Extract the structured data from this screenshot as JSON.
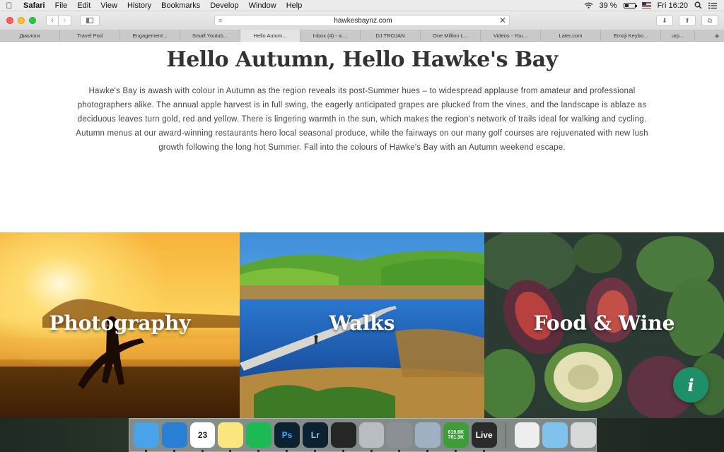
{
  "menubar": {
    "app_name": "Safari",
    "menus": [
      "File",
      "Edit",
      "View",
      "History",
      "Bookmarks",
      "Develop",
      "Window",
      "Help"
    ],
    "battery_percent": "39 %",
    "battery_level": 0.39,
    "clock": "Fri 16:20"
  },
  "browser": {
    "url": "hawkesbaynz.com",
    "tabs": [
      {
        "label": "Диалоги",
        "active": false
      },
      {
        "label": "Travel Pod",
        "active": false
      },
      {
        "label": "Engagement...",
        "active": false
      },
      {
        "label": "Small Youtub...",
        "active": false
      },
      {
        "label": "Hello Autum...",
        "active": true
      },
      {
        "label": "Inbox (4) - a....",
        "active": false
      },
      {
        "label": "DJ TROJAN",
        "active": false
      },
      {
        "label": "One Million L...",
        "active": false
      },
      {
        "label": "Videos - You...",
        "active": false
      },
      {
        "label": "Later.com",
        "active": false
      },
      {
        "label": "Emoji Keybo...",
        "active": false
      },
      {
        "label": "urp...",
        "active": false
      }
    ],
    "new_tab_label": "+"
  },
  "page": {
    "headline": "Hello Autumn, Hello Hawke's Bay",
    "intro": "Hawke's Bay is awash with colour in Autumn as the region reveals its post-Summer hues – to widespread applause from amateur and professional photographers alike. The annual apple harvest is in full swing, the eagerly anticipated grapes are plucked from the vines, and the landscape is ablaze as deciduous leaves turn gold, red and yellow. There is lingering warmth in the sun, which makes the region's network of trails ideal for walking and cycling. Autumn menus at our award-winning restaurants hero local seasonal produce, while the fairways on our many golf courses are rejuvenated with new lush growth following the long hot Summer. Fall into the colours of Hawke's Bay with an Autumn weekend escape.",
    "tiles": [
      {
        "label": "Photography",
        "image": "surfer-sunset-photo"
      },
      {
        "label": "Walks",
        "image": "wetland-boardwalk-photo"
      },
      {
        "label": "Food & Wine",
        "image": "feijoa-figs-photo"
      }
    ],
    "info_button_label": "i"
  },
  "dock": {
    "apps": [
      {
        "name": "finder-icon",
        "label": "",
        "bg": "#4aa3e8",
        "fg": "#fff"
      },
      {
        "name": "safari-icon",
        "label": "",
        "bg": "#2a7fd4",
        "fg": "#fff"
      },
      {
        "name": "calendar-icon",
        "label": "23",
        "bg": "#ffffff",
        "fg": "#222"
      },
      {
        "name": "notes-icon",
        "label": "",
        "bg": "#fbe680",
        "fg": "#333"
      },
      {
        "name": "spotify-icon",
        "label": "",
        "bg": "#1db954",
        "fg": "#111"
      },
      {
        "name": "photoshop-icon",
        "label": "Ps",
        "bg": "#0c2233",
        "fg": "#31a8ff"
      },
      {
        "name": "lightroom-icon",
        "label": "Lr",
        "bg": "#0c2233",
        "fg": "#9dc7e8"
      },
      {
        "name": "final-cut-icon",
        "label": "",
        "bg": "#262626",
        "fg": "#e85"
      },
      {
        "name": "disk-utility-icon",
        "label": "",
        "bg": "#b9bcc0",
        "fg": "#333"
      },
      {
        "name": "system-preferences-icon",
        "label": "",
        "bg": "#8c8f94",
        "fg": "#222"
      },
      {
        "name": "migration-icon",
        "label": "",
        "bg": "#9fb2c4",
        "fg": "#fff"
      },
      {
        "name": "network-monitor-icon",
        "label": "619.6K",
        "bg": "#3c9d3a",
        "fg": "#fff"
      },
      {
        "name": "ableton-live-icon",
        "label": "Live",
        "bg": "#2b2b2b",
        "fg": "#fff"
      },
      {
        "name": "vlc-icon",
        "label": "",
        "bg": "#eeeeee",
        "fg": "#f80"
      },
      {
        "name": "applications-folder-icon",
        "label": "",
        "bg": "#7fc2ee",
        "fg": "#fff"
      },
      {
        "name": "trash-icon",
        "label": "",
        "bg": "#d6d8da",
        "fg": "#555"
      }
    ],
    "network_down": "761.3K"
  }
}
